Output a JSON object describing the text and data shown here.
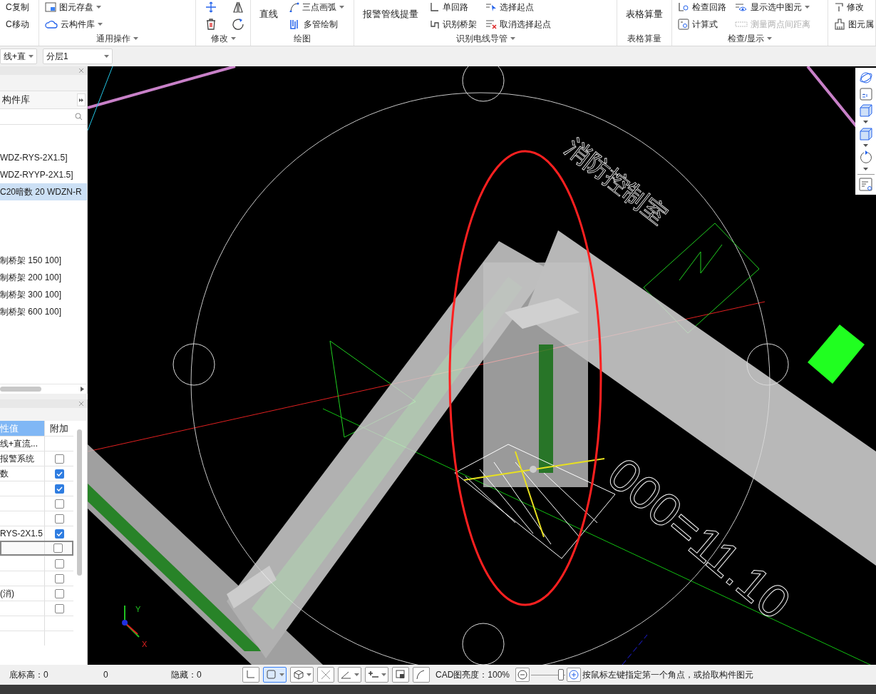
{
  "ribbon": {
    "groups": [
      {
        "columns": [
          [
            {
              "label": "C复制",
              "kind": "small"
            },
            {
              "label": "C移动",
              "kind": "small"
            }
          ]
        ]
      },
      {
        "label": "通用操作",
        "dropdown": true,
        "columns": [
          [
            {
              "label": "图元存盘",
              "kind": "small",
              "dropdown": true
            },
            {
              "label": "云构件库",
              "kind": "small",
              "dropdown": true
            }
          ]
        ]
      },
      {
        "label": "修改",
        "dropdown": true,
        "columns": [
          [
            {
              "kind": "icon"
            },
            {
              "kind": "icon"
            }
          ],
          [
            {
              "kind": "icon"
            },
            {
              "kind": "icon"
            }
          ]
        ]
      },
      {
        "label": "绘图",
        "dropdown": false,
        "columns": [
          [
            {
              "label": "直线",
              "kind": "large"
            }
          ],
          [
            {
              "label": "三点画弧",
              "kind": "small",
              "dropdown": true
            },
            {
              "label": "多管绘制",
              "kind": "small"
            }
          ]
        ]
      },
      {
        "label": "识别电线导管",
        "dropdown": true,
        "columns": [
          [
            {
              "label": "报警管线提量",
              "kind": "large"
            }
          ],
          [
            {
              "label": "单回路",
              "kind": "small"
            },
            {
              "label": "识别桥架",
              "kind": "small"
            }
          ],
          [
            {
              "label": "选择起点",
              "kind": "small"
            },
            {
              "label": "取消选择起点",
              "kind": "small"
            }
          ]
        ]
      },
      {
        "label": "表格算量",
        "dropdown": false,
        "columns": [
          [
            {
              "label": "表格算量",
              "kind": "large"
            }
          ]
        ]
      },
      {
        "label": "检查/显示",
        "dropdown": true,
        "columns": [
          [
            {
              "label": "检查回路",
              "kind": "small"
            },
            {
              "label": "计算式",
              "kind": "small"
            }
          ],
          [
            {
              "label": "显示选中图元",
              "kind": "small",
              "dropdown": true,
              "disabled": false
            },
            {
              "label": "测量两点间距离",
              "kind": "small",
              "disabled": true
            }
          ]
        ]
      },
      {
        "columns": [
          [
            {
              "label": "修改",
              "kind": "small"
            },
            {
              "label": "图元属",
              "kind": "small"
            }
          ]
        ]
      }
    ]
  },
  "toolbar": {
    "dropdowns": [
      {
        "value": "线+直"
      },
      {
        "value": "分层1"
      }
    ]
  },
  "library": {
    "tab": "构件库",
    "tree_groups": [
      {
        "items": [
          {
            "label": "WDZ-RYS-2X1.5]",
            "selected": false
          },
          {
            "label": "WDZ-RYYP-2X1.5]",
            "selected": false
          },
          {
            "label": "C20暗数 20 WDZN-R",
            "selected": true
          }
        ]
      },
      {
        "items": [
          {
            "label": "制桥架 150 100]",
            "selected": false
          },
          {
            "label": "制桥架 200 100]",
            "selected": false
          },
          {
            "label": "制桥架 300 100]",
            "selected": false
          },
          {
            "label": "制桥架 600 100]",
            "selected": false
          }
        ]
      }
    ]
  },
  "properties": {
    "columns": [
      "性值",
      "附加"
    ],
    "rows": [
      {
        "kind": "plain",
        "value": "线+直流...",
        "selected": false
      },
      {
        "kind": "checkbox",
        "value": "报警系统",
        "checked": false,
        "selected": false
      },
      {
        "kind": "checkbox",
        "value": "数",
        "checked": true,
        "selected": false
      },
      {
        "kind": "checkbox",
        "checked": true,
        "selected": false
      },
      {
        "kind": "checkbox",
        "checked": false,
        "selected": false
      },
      {
        "kind": "checkbox",
        "checked": false,
        "selected": false
      },
      {
        "kind": "checkbox",
        "value": "RYS-2X1.5",
        "checked": true,
        "selected": false
      },
      {
        "kind": "checkbox",
        "checked": false,
        "selected": true
      },
      {
        "kind": "checkbox",
        "checked": false,
        "selected": false
      },
      {
        "kind": "checkbox",
        "checked": false,
        "selected": false
      },
      {
        "kind": "checkbox",
        "value": "(消)",
        "checked": false,
        "selected": false
      },
      {
        "kind": "checkbox",
        "checked": false,
        "selected": false
      },
      {
        "kind": "plain",
        "selected": false
      },
      {
        "kind": "plain",
        "selected": false
      }
    ]
  },
  "canvas": {
    "labels": [
      {
        "text": "消防控制室"
      },
      {
        "text": "000=11.10"
      }
    ],
    "axes": {
      "x": "X",
      "y": "Y"
    }
  },
  "status_bar": {
    "fields": [
      "底标高：0",
      "0",
      "隐藏：0"
    ],
    "tools": [
      {
        "dropdown": false,
        "selected": false
      },
      {
        "dropdown": true,
        "selected": true
      },
      {
        "dropdown": true,
        "selected": false
      },
      {
        "dropdown": false,
        "selected": false
      },
      {
        "dropdown": true,
        "selected": false
      },
      {
        "dropdown": true,
        "selected": false
      },
      {
        "dropdown": false,
        "selected": false
      },
      {
        "dropdown": false,
        "selected": false
      }
    ],
    "brightness": {
      "label": "CAD图亮度：100%",
      "level": 0.95
    },
    "hint": "按鼠标左键指定第一个角点，或拾取构件图元"
  }
}
